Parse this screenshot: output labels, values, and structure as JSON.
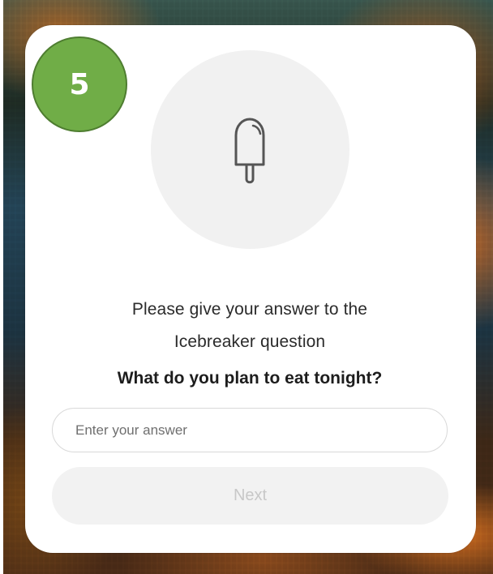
{
  "badge": {
    "number": "5",
    "color": "#70ad47"
  },
  "icon": {
    "name": "popsicle-icon"
  },
  "prompt": {
    "line1": "Please give your answer to the",
    "line2": "Icebreaker question"
  },
  "question": {
    "text": "What do you plan to eat tonight?"
  },
  "answer": {
    "placeholder": "Enter your answer",
    "value": ""
  },
  "actions": {
    "next_label": "Next"
  },
  "colors": {
    "card": "#ffffff",
    "icon_circle": "#f1f1f1",
    "button_background": "#f2f2f2",
    "button_text": "#c8c8c8"
  }
}
